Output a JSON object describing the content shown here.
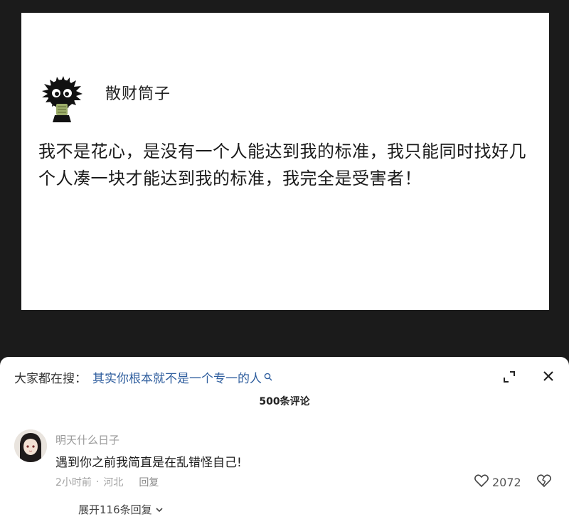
{
  "post": {
    "author": "散财筒子",
    "text": "我不是花心，是没有一个人能达到我的标准，我只能同时找好几个人凑一块才能达到我的标准，我完全是受害者！"
  },
  "comments_panel": {
    "search_prefix": "大家都在搜：",
    "search_query": "其实你根本就不是一个专一的人",
    "comment_count": "500条评论",
    "comment": {
      "username": "明天什么日子",
      "text": "遇到你之前我简直是在乱错怪自己!",
      "time": "2小时前",
      "separator": "·",
      "location": "河北",
      "reply_label": "回复",
      "like_count": "2072",
      "expand_replies": "展开116条回复"
    }
  },
  "icons": {
    "search": "search-icon",
    "expand": "expand-icon",
    "close": "close-icon",
    "like": "heart-icon",
    "dislike": "broken-heart-icon",
    "chevron": "chevron-down-icon"
  },
  "colors": {
    "background": "#1b1b1b",
    "search_link": "#2f5e9e"
  }
}
